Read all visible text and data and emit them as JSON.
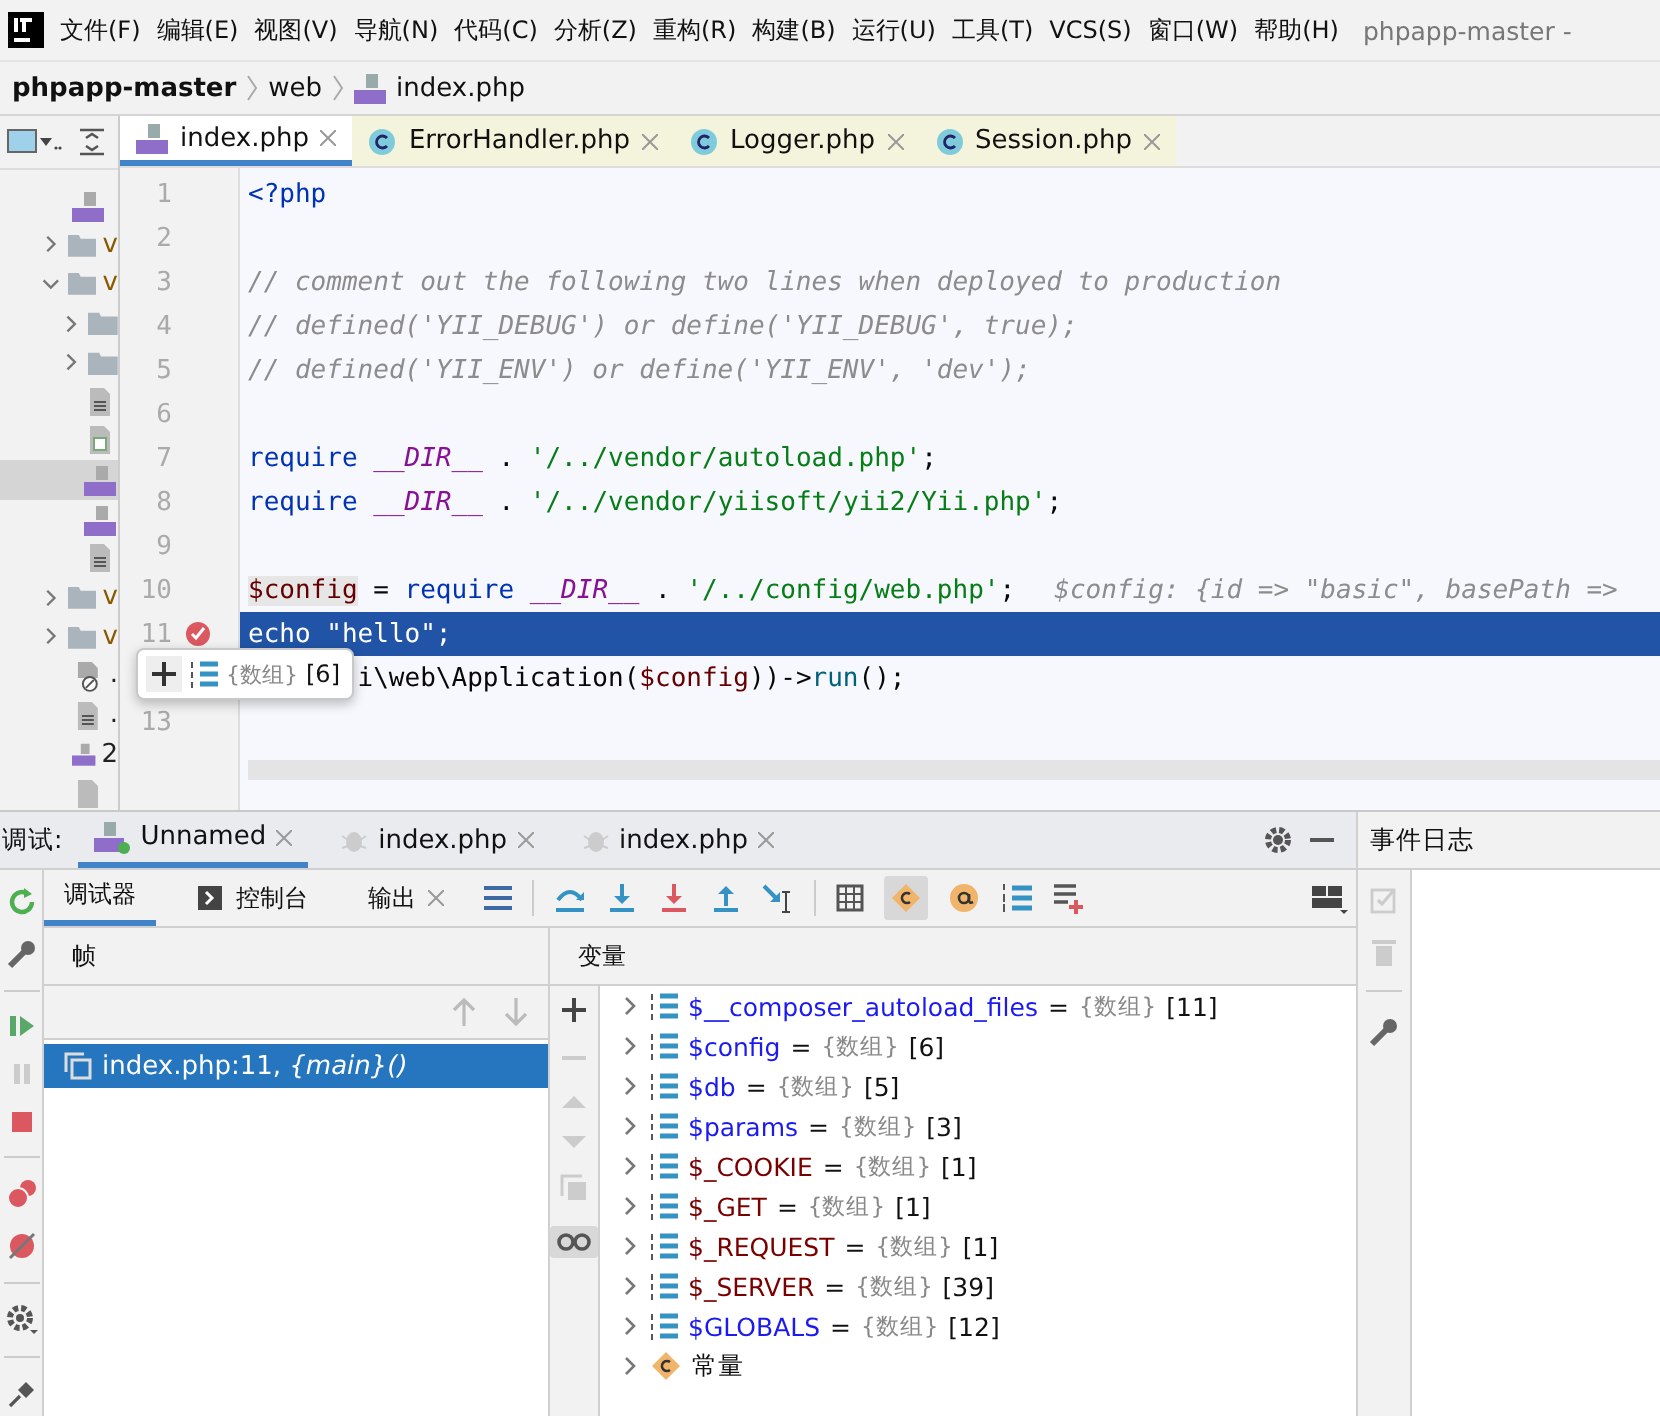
{
  "menu_bar": {
    "items": [
      "文件(F)",
      "编辑(E)",
      "视图(V)",
      "导航(N)",
      "代码(C)",
      "分析(Z)",
      "重构(R)",
      "构建(B)",
      "运行(U)",
      "工具(T)",
      "VCS(S)",
      "窗口(W)",
      "帮助(H)"
    ],
    "title": "phpapp-master -"
  },
  "breadcrumbs": [
    {
      "label": "phpapp-master",
      "kind": "project"
    },
    {
      "label": "web",
      "kind": "folder"
    },
    {
      "label": "index.php",
      "kind": "php"
    }
  ],
  "project_tree": [
    {
      "kind": "php",
      "selected": false
    },
    {
      "kind": "folder",
      "label": "v",
      "expanded": false,
      "selected": false
    },
    {
      "kind": "folder",
      "label": "v",
      "expanded": true,
      "selected": false,
      "children": [
        {
          "kind": "folder",
          "expanded": false,
          "selected": false
        },
        {
          "kind": "folder",
          "expanded": false,
          "selected": false
        },
        {
          "kind": "text",
          "selected": false
        },
        {
          "kind": "config",
          "selected": false
        },
        {
          "kind": "php",
          "selected": true
        },
        {
          "kind": "php",
          "selected": false
        },
        {
          "kind": "text",
          "selected": false
        }
      ]
    },
    {
      "kind": "folder",
      "label": "v",
      "expanded": false,
      "selected": false
    },
    {
      "kind": "folder",
      "label": "v",
      "expanded": false,
      "selected": false
    },
    {
      "kind": "ignored",
      "label": ".",
      "selected": false
    },
    {
      "kind": "text",
      "label": ".",
      "selected": false
    },
    {
      "kind": "php",
      "label": "2",
      "selected": false
    },
    {
      "kind": "file",
      "selected": false
    }
  ],
  "editor_tabs": [
    {
      "label": "index.php",
      "kind": "php",
      "selected": true
    },
    {
      "label": "ErrorHandler.php",
      "kind": "class",
      "selected": false
    },
    {
      "label": "Logger.php",
      "kind": "class",
      "selected": false
    },
    {
      "label": "Session.php",
      "kind": "class",
      "selected": false
    }
  ],
  "code_lines": [
    {
      "number": "1",
      "tokens": [
        {
          "text": "<?php",
          "kind": "tag"
        }
      ]
    },
    {
      "number": "2"
    },
    {
      "number": "3",
      "tokens": [
        {
          "text": "// comment out the following two lines when deployed to production",
          "kind": "comment"
        }
      ]
    },
    {
      "number": "4",
      "tokens": [
        {
          "text": "// defined('YII_DEBUG') or define('YII_DEBUG', true);",
          "kind": "comment"
        }
      ]
    },
    {
      "number": "5",
      "tokens": [
        {
          "text": "// defined('YII_ENV') or define('YII_ENV', 'dev');",
          "kind": "comment"
        }
      ]
    },
    {
      "number": "6"
    },
    {
      "number": "7",
      "tokens": [
        {
          "text": "require ",
          "kind": "keyword"
        },
        {
          "text": "__DIR__",
          "kind": "constant"
        },
        {
          "text": " . ",
          "kind": "plain"
        },
        {
          "text": "'/../vendor/autoload.php'",
          "kind": "string"
        },
        {
          "text": ";",
          "kind": "plain"
        }
      ]
    },
    {
      "number": "8",
      "tokens": [
        {
          "text": "require ",
          "kind": "keyword"
        },
        {
          "text": "__DIR__",
          "kind": "constant"
        },
        {
          "text": " . ",
          "kind": "plain"
        },
        {
          "text": "'/../vendor/yiisoft/yii2/Yii.php'",
          "kind": "string"
        },
        {
          "text": ";",
          "kind": "plain"
        }
      ]
    },
    {
      "number": "9"
    },
    {
      "number": "10",
      "tokens": [
        {
          "text": "$config",
          "kind": "variable-marked"
        },
        {
          "text": " = ",
          "kind": "plain"
        },
        {
          "text": "require ",
          "kind": "keyword"
        },
        {
          "text": "__DIR__",
          "kind": "constant"
        },
        {
          "text": " . ",
          "kind": "plain"
        },
        {
          "text": "'/../config/web.php'",
          "kind": "string"
        },
        {
          "text": ";",
          "kind": "plain"
        },
        {
          "text": "$config: {id => \"basic\", basePath =>",
          "kind": "hint"
        }
      ]
    },
    {
      "number": "11",
      "breakpoint": true,
      "current": true,
      "tokens": [
        {
          "text": "echo \"hello\";",
          "kind": "plain"
        }
      ]
    },
    {
      "covered": true,
      "tokens": [
        {
          "text": "i\\web\\Application(",
          "kind": "plain"
        },
        {
          "text": "$config",
          "kind": "variable"
        },
        {
          "text": "))->",
          "kind": "plain"
        },
        {
          "text": "run",
          "kind": "function"
        },
        {
          "text": "();",
          "kind": "plain"
        }
      ]
    },
    {
      "number": "13"
    }
  ],
  "value_popup": {
    "type": "{数组}",
    "count": "[6]"
  },
  "debug": {
    "title": "调试:",
    "tabs": [
      {
        "label": "Unnamed",
        "kind": "php-run",
        "selected": true
      },
      {
        "label": "index.php",
        "kind": "bug",
        "selected": false
      },
      {
        "label": "index.php",
        "kind": "bug",
        "selected": false
      }
    ],
    "subtabs": [
      {
        "label": "调试器",
        "kind": "plain",
        "selected": true
      },
      {
        "label": "控制台",
        "kind": "console",
        "selected": false
      },
      {
        "label": "输出",
        "kind": "closable",
        "selected": false
      }
    ],
    "show_constants_on": true,
    "inline_values_on": true,
    "frames_header": "帧",
    "variables_header": "变量",
    "frames": [
      {
        "text": "index.php:11, *{main}()*",
        "selected": true
      }
    ],
    "variables": [
      {
        "name": "$__composer_autoload_files",
        "kind": "local",
        "operator": "=",
        "type": "{数组}",
        "count": "[11]"
      },
      {
        "name": "$config",
        "kind": "local",
        "operator": "=",
        "type": "{数组}",
        "count": "[6]"
      },
      {
        "name": "$db",
        "kind": "local",
        "operator": "=",
        "type": "{数组}",
        "count": "[5]"
      },
      {
        "name": "$params",
        "kind": "local",
        "operator": "=",
        "type": "{数组}",
        "count": "[3]"
      },
      {
        "name": "$_COOKIE",
        "kind": "superglobal",
        "operator": "=",
        "type": "{数组}",
        "count": "[1]"
      },
      {
        "name": "$_GET",
        "kind": "superglobal",
        "operator": "=",
        "type": "{数组}",
        "count": "[1]"
      },
      {
        "name": "$_REQUEST",
        "kind": "superglobal",
        "operator": "=",
        "type": "{数组}",
        "count": "[1]"
      },
      {
        "name": "$_SERVER",
        "kind": "superglobal",
        "operator": "=",
        "type": "{数组}",
        "count": "[39]"
      },
      {
        "name": "$GLOBALS",
        "kind": "local",
        "operator": "=",
        "type": "{数组}",
        "count": "[12]"
      },
      {
        "name": "常量",
        "kind": "constants"
      }
    ]
  },
  "event_log": {
    "title": "事件日志"
  }
}
